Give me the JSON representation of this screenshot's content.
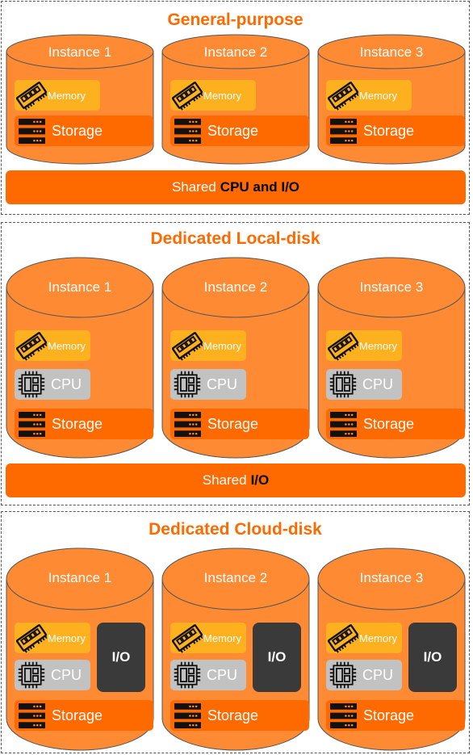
{
  "colors": {
    "accent": "#ff6a00",
    "cylinder": "#fe8a33",
    "memory": "#fdb11e",
    "cpu": "#c2c2c2",
    "storage": "#ff6a00",
    "io": "#3a3a3a"
  },
  "sections": [
    {
      "title": "General-purpose",
      "instances": [
        {
          "label": "Instance 1",
          "memory": "Memory",
          "storage": "Storage"
        },
        {
          "label": "Instance 2",
          "memory": "Memory",
          "storage": "Storage"
        },
        {
          "label": "Instance 3",
          "memory": "Memory",
          "storage": "Storage"
        }
      ],
      "shared": {
        "prefix": "Shared",
        "bold": "CPU and I/O"
      }
    },
    {
      "title": "Dedicated Local-disk",
      "instances": [
        {
          "label": "Instance 1",
          "memory": "Memory",
          "cpu": "CPU",
          "storage": "Storage"
        },
        {
          "label": "Instance 2",
          "memory": "Memory",
          "cpu": "CPU",
          "storage": "Storage"
        },
        {
          "label": "Instance 3",
          "memory": "Memory",
          "cpu": "CPU",
          "storage": "Storage"
        }
      ],
      "shared": {
        "prefix": "Shared",
        "bold": "I/O"
      }
    },
    {
      "title": "Dedicated Cloud-disk",
      "instances": [
        {
          "label": "Instance 1",
          "memory": "Memory",
          "cpu": "CPU",
          "storage": "Storage",
          "io": "I/O"
        },
        {
          "label": "Instance 2",
          "memory": "Memory",
          "cpu": "CPU",
          "storage": "Storage",
          "io": "I/O"
        },
        {
          "label": "Instance 3",
          "memory": "Memory",
          "cpu": "CPU",
          "storage": "Storage",
          "io": "I/O"
        }
      ]
    }
  ]
}
